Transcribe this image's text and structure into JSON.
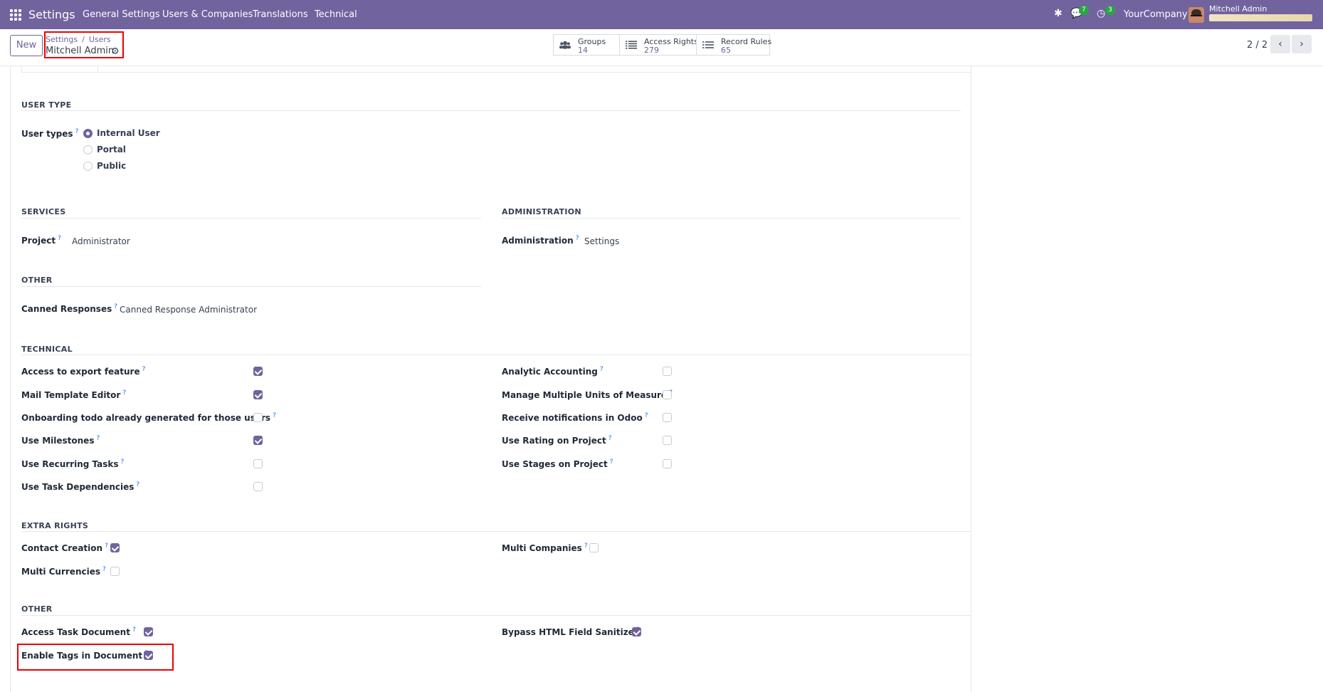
{
  "navbar": {
    "app_name": "Settings",
    "menus": [
      "General Settings",
      "Users & Companies",
      "Translations",
      "Technical"
    ],
    "chat_count": "7",
    "activity_count": "3",
    "company": "YourCompany",
    "user": "Mitchell Admin"
  },
  "control": {
    "new_label": "New",
    "breadcrumb": [
      "Settings",
      "Users"
    ],
    "record_name": "Mitchell Admin",
    "smart_buttons": [
      {
        "label": "Groups",
        "count": "14",
        "icon": "users-icon"
      },
      {
        "label": "Access Rights",
        "count": "279",
        "icon": "list-icon"
      },
      {
        "label": "Record Rules",
        "count": "65",
        "icon": "list-icon"
      }
    ],
    "pager": "2 / 2"
  },
  "form": {
    "user_type": {
      "title": "USER TYPE",
      "label": "User types",
      "options": [
        "Internal User",
        "Portal",
        "Public"
      ],
      "selected": "Internal User"
    },
    "services": {
      "title": "SERVICES",
      "label": "Project",
      "value": "Administrator"
    },
    "administration": {
      "title": "ADMINISTRATION",
      "label": "Administration",
      "value": "Settings"
    },
    "other1": {
      "title": "OTHER",
      "label": "Canned Responses",
      "value": "Canned Response Administrator"
    },
    "technical": {
      "title": "TECHNICAL",
      "left": [
        {
          "label": "Access to export feature",
          "checked": true
        },
        {
          "label": "Mail Template Editor",
          "checked": true
        },
        {
          "label": "Onboarding todo already generated for those users",
          "checked": false
        },
        {
          "label": "Use Milestones",
          "checked": true
        },
        {
          "label": "Use Recurring Tasks",
          "checked": false
        },
        {
          "label": "Use Task Dependencies",
          "checked": false
        }
      ],
      "right": [
        {
          "label": "Analytic Accounting",
          "checked": false
        },
        {
          "label": "Manage Multiple Units of Measure",
          "checked": false
        },
        {
          "label": "Receive notifications in Odoo",
          "checked": false
        },
        {
          "label": "Use Rating on Project",
          "checked": false
        },
        {
          "label": "Use Stages on Project",
          "checked": false
        }
      ]
    },
    "extra_rights": {
      "title": "EXTRA RIGHTS",
      "left": [
        {
          "label": "Contact Creation",
          "checked": true
        },
        {
          "label": "Multi Currencies",
          "checked": false
        }
      ],
      "right": [
        {
          "label": "Multi Companies",
          "checked": false
        }
      ]
    },
    "other2": {
      "title": "OTHER",
      "left": [
        {
          "label": "Access Task Document",
          "checked": true
        },
        {
          "label": "Enable Tags in Document",
          "checked": true
        }
      ],
      "right": [
        {
          "label": "Bypass HTML Field Sanitize",
          "checked": true
        }
      ]
    },
    "help_mark": "?"
  }
}
